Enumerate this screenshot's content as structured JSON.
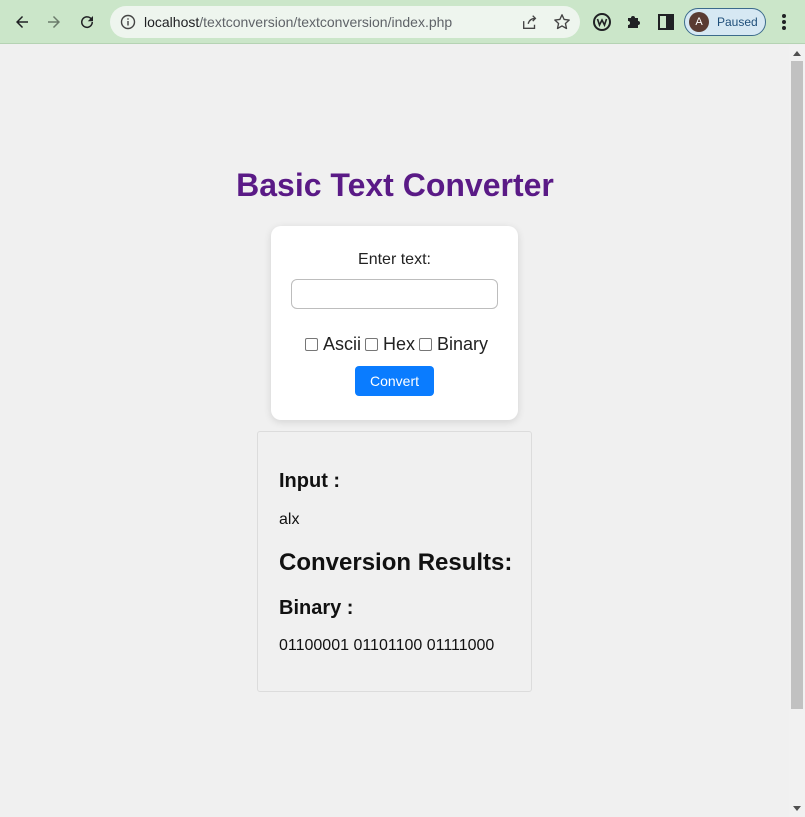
{
  "browser": {
    "url_host": "localhost",
    "url_path": "/textconversion/textconversion/index.php",
    "profile_initial": "A",
    "profile_status": "Paused",
    "icons": [
      "back-icon",
      "forward-icon",
      "reload-icon",
      "info-icon",
      "share-icon",
      "star-icon",
      "extension-w-icon",
      "puzzle-icon",
      "sidepanel-icon",
      "menu-icon"
    ]
  },
  "page": {
    "title": "Basic Text Converter",
    "form": {
      "label": "Enter text:",
      "input_value": "",
      "options": [
        {
          "label": "Ascii",
          "checked": false
        },
        {
          "label": "Hex",
          "checked": false
        },
        {
          "label": "Binary",
          "checked": false
        }
      ],
      "submit_label": "Convert"
    },
    "results": {
      "input_heading": "Input :",
      "input_value": "alx",
      "conversion_heading": "Conversion Results:",
      "binary_heading": "Binary :",
      "binary_value": "01100001 01101100 01111000"
    }
  },
  "colors": {
    "title": "#5a1a86",
    "button": "#0a7cff",
    "chrome": "#cbe6c9"
  }
}
